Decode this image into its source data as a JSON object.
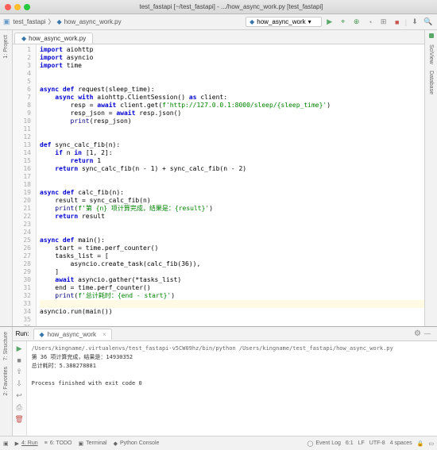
{
  "window": {
    "title": "test_fastapi [~/test_fastapi] - .../how_async_work.py [test_fastapi]"
  },
  "breadcrumb": {
    "root": "test_fastapi",
    "file": "how_async_work.py"
  },
  "run_config": {
    "selected": "how_async_work"
  },
  "tab": {
    "file": "how_async_work.py"
  },
  "left_tabs": {
    "project": "1: Project",
    "structure": "7: Structure",
    "favorites": "2: Favorites"
  },
  "right_tabs": {
    "sciview": "SciView",
    "database": "Database"
  },
  "code": {
    "lines": [
      "import aiohttp",
      "import asyncio",
      "import time",
      "",
      "",
      "async def request(sleep_time):",
      "    async with aiohttp.ClientSession() as client:",
      "        resp = await client.get(f'http://127.0.0.1:8000/sleep/{sleep_time}')",
      "        resp_json = await resp.json()",
      "        print(resp_json)",
      "",
      "",
      "def sync_calc_fib(n):",
      "    if n in [1, 2]:",
      "        return 1",
      "    return sync_calc_fib(n - 1) + sync_calc_fib(n - 2)",
      "",
      "",
      "async def calc_fib(n):",
      "    result = sync_calc_fib(n)",
      "    print(f'第 {n} 项计算完成，结果是：{result}')",
      "    return result",
      "",
      "",
      "async def main():",
      "    start = time.perf_counter()",
      "    tasks_list = [",
      "        asyncio.create_task(calc_fib(36)),",
      "    ]",
      "    await asyncio.gather(*tasks_list)",
      "    end = time.perf_counter()",
      "    print(f'总计耗时：{end - start}')",
      "",
      "",
      "asyncio.run(main())",
      ""
    ]
  },
  "run": {
    "label": "Run:",
    "tab": "how_async_work",
    "output": [
      "/Users/kingname/.virtualenvs/test_fastapi-v5CW09hz/bin/python /Users/kingname/test_fastapi/how_async_work.py",
      "第 36 项计算完成，结果是：14930352",
      "总计耗时：5.388278881",
      "",
      "Process finished with exit code 0",
      ""
    ]
  },
  "statusbar": {
    "run": "4: Run",
    "todo": "6: TODO",
    "terminal": "Terminal",
    "python_console": "Python Console",
    "event_log": "Event Log",
    "position": "6:1",
    "line_sep": "LF",
    "encoding": "UTF-8",
    "indent": "4 spaces"
  }
}
